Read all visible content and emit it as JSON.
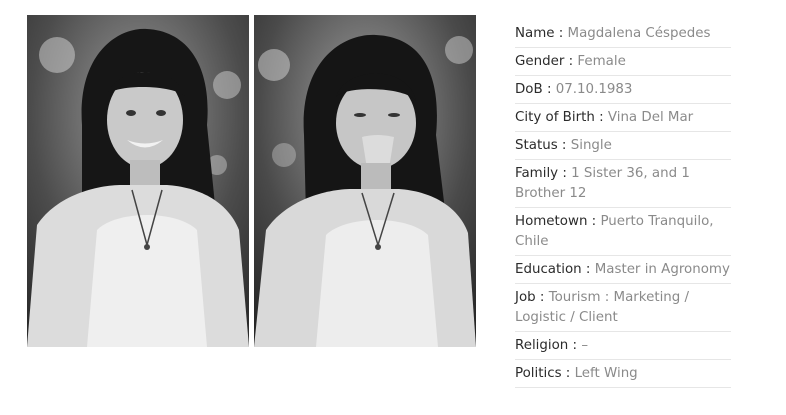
{
  "photos": [
    {
      "alt": "portrait-smiling"
    },
    {
      "alt": "portrait-tongue-out"
    }
  ],
  "profile": {
    "fields": [
      {
        "label": "Name :",
        "value": "Magdalena Céspedes"
      },
      {
        "label": "Gender :",
        "value": "Female"
      },
      {
        "label": "DoB :",
        "value": "07.10.1983"
      },
      {
        "label": "City of Birth :",
        "value": "Vina Del Mar"
      },
      {
        "label": "Status :",
        "value": "Single"
      },
      {
        "label": "Family :",
        "value": "1 Sister 36,  and 1 Brother 12"
      },
      {
        "label": "Hometown :",
        "value": "Puerto Tranquilo, Chile"
      },
      {
        "label": "Education :",
        "value": "Master in Agronomy"
      },
      {
        "label": "Job :",
        "value": "Tourism : Marketing / Logistic / Client"
      },
      {
        "label": "Religion :",
        "value": "–"
      },
      {
        "label": "Politics :",
        "value": "Left Wing"
      }
    ]
  }
}
